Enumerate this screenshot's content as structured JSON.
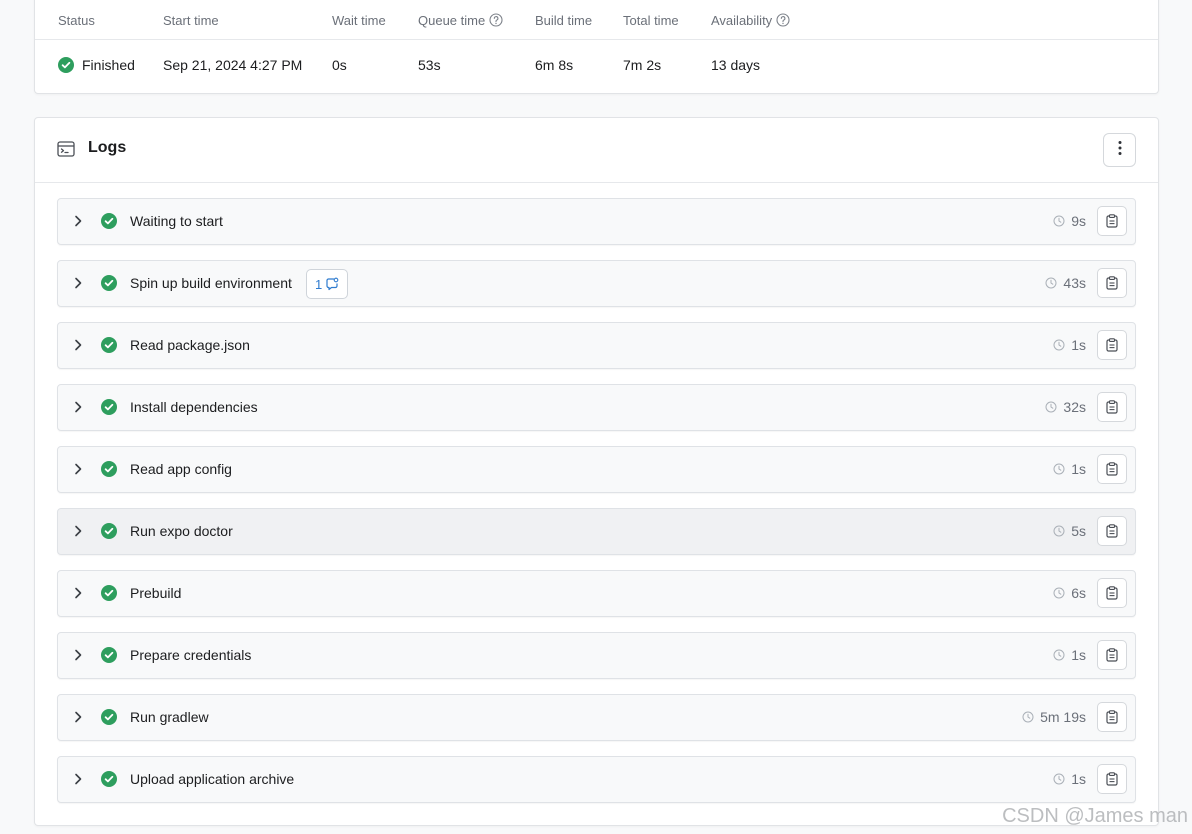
{
  "stats": {
    "headers": {
      "status": "Status",
      "start_time": "Start time",
      "wait_time": "Wait time",
      "queue_time": "Queue time",
      "build_time": "Build time",
      "total_time": "Total time",
      "availability": "Availability"
    },
    "values": {
      "status": "Finished",
      "start_time": "Sep 21, 2024 4:27 PM",
      "wait_time": "0s",
      "queue_time": "53s",
      "build_time": "6m 8s",
      "total_time": "7m 2s",
      "availability": "13 days"
    }
  },
  "logs": {
    "title": "Logs",
    "steps": [
      {
        "name": "Waiting to start",
        "duration": "9s"
      },
      {
        "name": "Spin up build environment",
        "duration": "43s",
        "badge": "1"
      },
      {
        "name": "Read package.json",
        "duration": "1s"
      },
      {
        "name": "Install dependencies",
        "duration": "32s"
      },
      {
        "name": "Read app config",
        "duration": "1s"
      },
      {
        "name": "Run expo doctor",
        "duration": "5s"
      },
      {
        "name": "Prebuild",
        "duration": "6s"
      },
      {
        "name": "Prepare credentials",
        "duration": "1s"
      },
      {
        "name": "Run gradlew",
        "duration": "5m 19s"
      },
      {
        "name": "Upload application archive",
        "duration": "1s"
      }
    ]
  },
  "watermark": "CSDN @James man",
  "colors": {
    "success": "#2e9e5e",
    "link": "#2e7bcf",
    "muted": "#6b7079"
  },
  "icons": [
    "check-circle-icon",
    "help-circle-icon",
    "terminal-icon",
    "more-vertical-icon",
    "chevron-right-icon",
    "clock-icon",
    "clipboard-icon",
    "comment-icon"
  ]
}
